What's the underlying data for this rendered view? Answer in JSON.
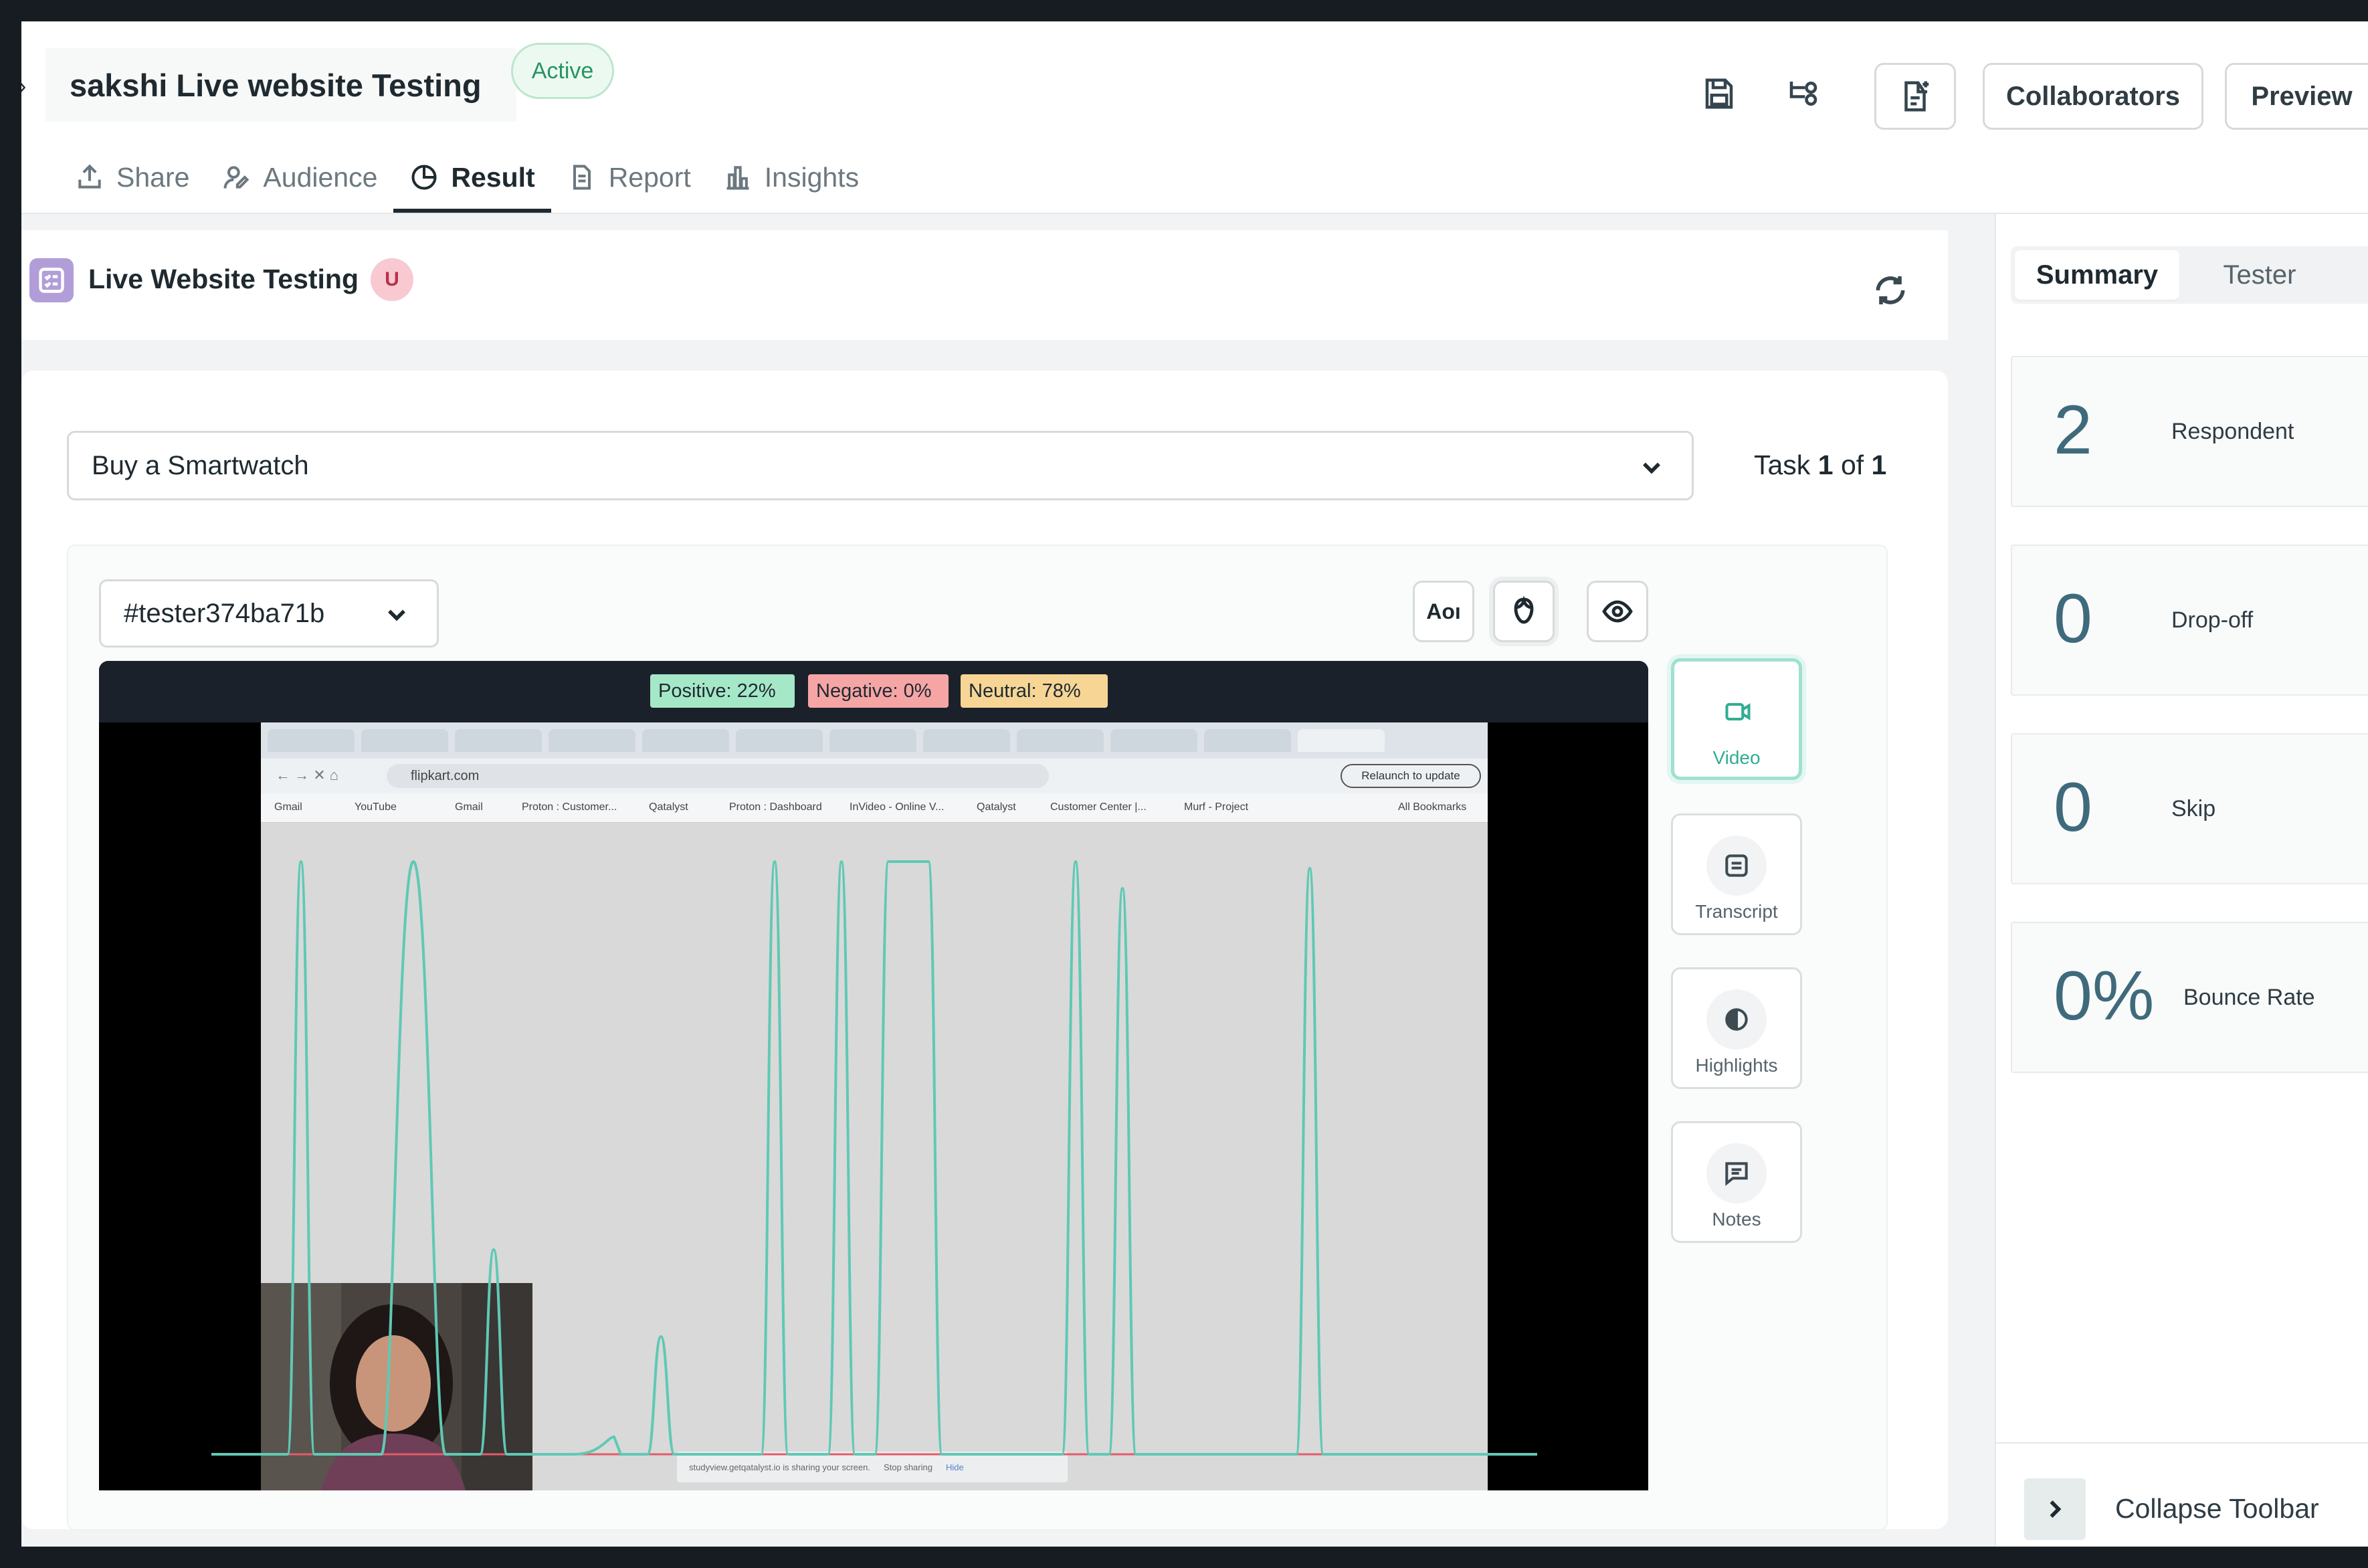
{
  "header": {
    "title": "sakshi Live website Testing",
    "status": "Active",
    "collaborators_label": "Collaborators",
    "preview_label": "Preview"
  },
  "tabs": [
    {
      "label": "Share",
      "icon": "share-icon",
      "active": false
    },
    {
      "label": "Audience",
      "icon": "audience-icon",
      "active": false
    },
    {
      "label": "Result",
      "icon": "pie-chart-icon",
      "active": true
    },
    {
      "label": "Report",
      "icon": "report-icon",
      "active": false
    },
    {
      "label": "Insights",
      "icon": "bar-chart-icon",
      "active": false
    }
  ],
  "section": {
    "title": "Live Website Testing",
    "avatar_initial": "U"
  },
  "task": {
    "selected": "Buy a Smartwatch",
    "count_prefix": "Task",
    "current": "1",
    "of_word": "of",
    "total": "1"
  },
  "tester": {
    "selected": "#tester374ba71b"
  },
  "tools": {
    "aoi_label": "Aoı"
  },
  "sentiment": {
    "positive": "Positive:  22%",
    "negative": "Negative:  0%",
    "neutral": "Neutral:  78%"
  },
  "browser": {
    "url": "flipkart.com",
    "relaunch": "Relaunch to update",
    "bookmarks": [
      "Gmail",
      "YouTube",
      "Gmail",
      "Proton : Customer...",
      "Qatalyst",
      "Proton : Dashboard",
      "InVideo - Online V...",
      "Qatalyst",
      "Customer Center |...",
      "Murf - Project",
      "All Bookmarks"
    ],
    "share_notice": "studyview.getqatalyst.io is sharing your screen.",
    "stop_sharing": "Stop sharing",
    "hide": "Hide"
  },
  "side_panel": [
    {
      "label": "Video",
      "icon": "video-icon",
      "active": true
    },
    {
      "label": "Transcript",
      "icon": "transcript-icon",
      "active": false
    },
    {
      "label": "Highlights",
      "icon": "highlights-icon",
      "active": false
    },
    {
      "label": "Notes",
      "icon": "notes-icon",
      "active": false
    }
  ],
  "summary": {
    "tabs": [
      "Summary",
      "Tester"
    ],
    "stats": [
      {
        "value": "2",
        "label": "Respondent"
      },
      {
        "value": "0",
        "label": "Drop-off"
      },
      {
        "value": "0",
        "label": "Skip"
      },
      {
        "value": "0%",
        "label": "Bounce Rate"
      }
    ],
    "collapse_label": "Collapse Toolbar"
  },
  "colors": {
    "accent_teal": "#31ad92",
    "wave_teal": "#5fc9b4",
    "stat_number": "#3f6a7c",
    "active_badge": "#279561"
  }
}
